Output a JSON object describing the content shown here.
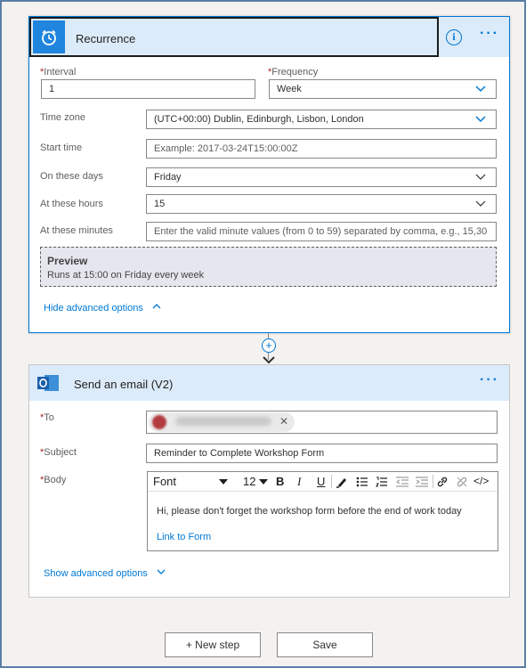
{
  "recurrence": {
    "title": "Recurrence",
    "more": "···",
    "interval_label": "Interval",
    "interval_value": "1",
    "frequency_label": "Frequency",
    "frequency_value": "Week",
    "timezone_label": "Time zone",
    "timezone_value": "(UTC+00:00) Dublin, Edinburgh, Lisbon, London",
    "start_time_label": "Start time",
    "start_time_placeholder": "Example: 2017-03-24T15:00:00Z",
    "days_label": "On these days",
    "days_value": "Friday",
    "hours_label": "At these hours",
    "hours_value": "15",
    "minutes_label": "At these minutes",
    "minutes_placeholder": "Enter the valid minute values (from 0 to 59) separated by comma, e.g., 15,30",
    "preview_title": "Preview",
    "preview_text": "Runs at 15:00 on Friday every week",
    "hide_advanced": "Hide advanced options"
  },
  "email": {
    "title": "Send an email (V2)",
    "more": "···",
    "to_label": "To",
    "subject_label": "Subject",
    "subject_value": "Reminder to Complete Workshop Form",
    "body_label": "Body",
    "font_value": "Font",
    "font_size_value": "12",
    "body_text": "Hi, please don't forget the workshop form before the end of work today",
    "body_link": "Link to Form",
    "show_advanced": "Show advanced options"
  },
  "footer": {
    "new_step": "+ New step",
    "save": "Save"
  },
  "colors": {
    "accent": "#0078d4",
    "header_bg": "#dcebfa",
    "required": "#a4262c"
  }
}
